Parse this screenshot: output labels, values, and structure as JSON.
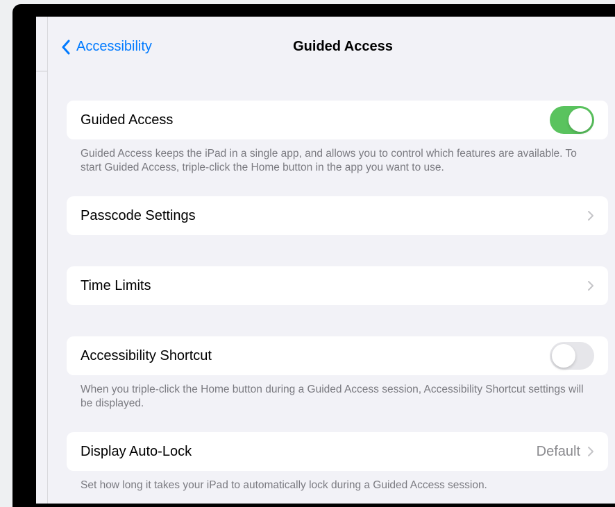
{
  "nav": {
    "back_label": "Accessibility",
    "title": "Guided Access"
  },
  "rows": {
    "guided_access": {
      "label": "Guided Access",
      "toggle": "on"
    },
    "guided_access_footer": "Guided Access keeps the iPad in a single app, and allows you to control which features are available. To start Guided Access, triple-click the Home button in the app you want to use.",
    "passcode_settings": {
      "label": "Passcode Settings"
    },
    "time_limits": {
      "label": "Time Limits"
    },
    "accessibility_shortcut": {
      "label": "Accessibility Shortcut",
      "toggle": "off"
    },
    "accessibility_shortcut_footer": "When you triple-click the Home button during a Guided Access session, Accessibility Shortcut settings will be displayed.",
    "display_auto_lock": {
      "label": "Display Auto-Lock",
      "value": "Default"
    },
    "display_auto_lock_footer": "Set how long it takes your iPad to automatically lock during a Guided Access session."
  },
  "colors": {
    "accent": "#007aff",
    "toggle_on": "#5ac35e",
    "toggle_off": "#e6e6ea",
    "background": "#f2f2f7"
  },
  "icons": {
    "back": "chevron-left-icon",
    "disclosure": "chevron-right-icon",
    "battery": "battery-icon"
  }
}
